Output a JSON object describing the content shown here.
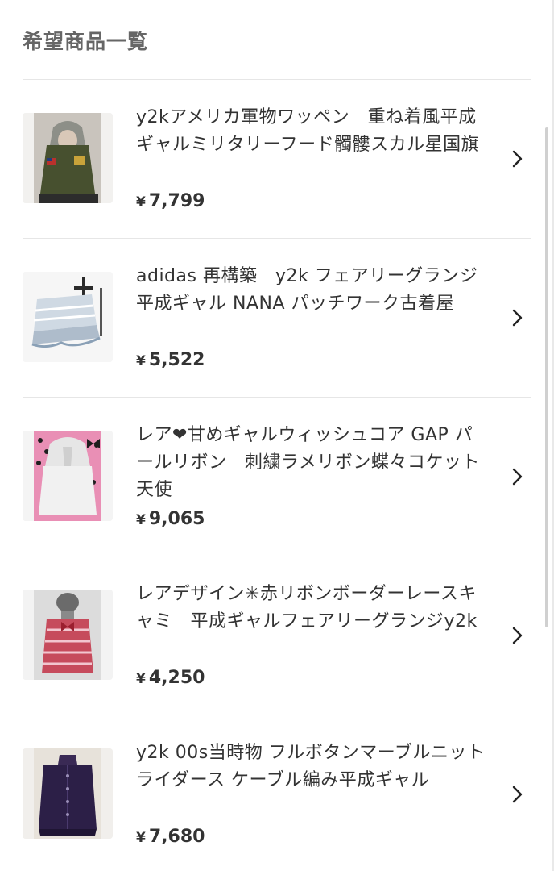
{
  "header": {
    "title": "希望商品一覧"
  },
  "icons": {
    "item_chevron": "chevron-right-icon"
  },
  "items": [
    {
      "name": "y2kアメリカ軍物ワッペン　重ね着風平成ギャルミリタリーフード髑髏スカル星国旗",
      "currency": "¥",
      "price": "7,799"
    },
    {
      "name": "adidas 再構築　y2k フェアリーグランジ平成ギャル NANA パッチワーク古着屋",
      "currency": "¥",
      "price": "5,522"
    },
    {
      "name": "レア❤甘めギャルウィッシュコア GAP パールリボン　刺繍ラメリボン蝶々コケット天使",
      "currency": "¥",
      "price": "9,065"
    },
    {
      "name": "レアデザイン✳赤リボンボーダーレースキャミ　平成ギャルフェアリーグランジy2k",
      "currency": "¥",
      "price": "4,250"
    },
    {
      "name": "y2k 00s当時物 フルボタンマーブルニットライダース ケーブル編み平成ギャル",
      "currency": "¥",
      "price": "7,680"
    }
  ]
}
